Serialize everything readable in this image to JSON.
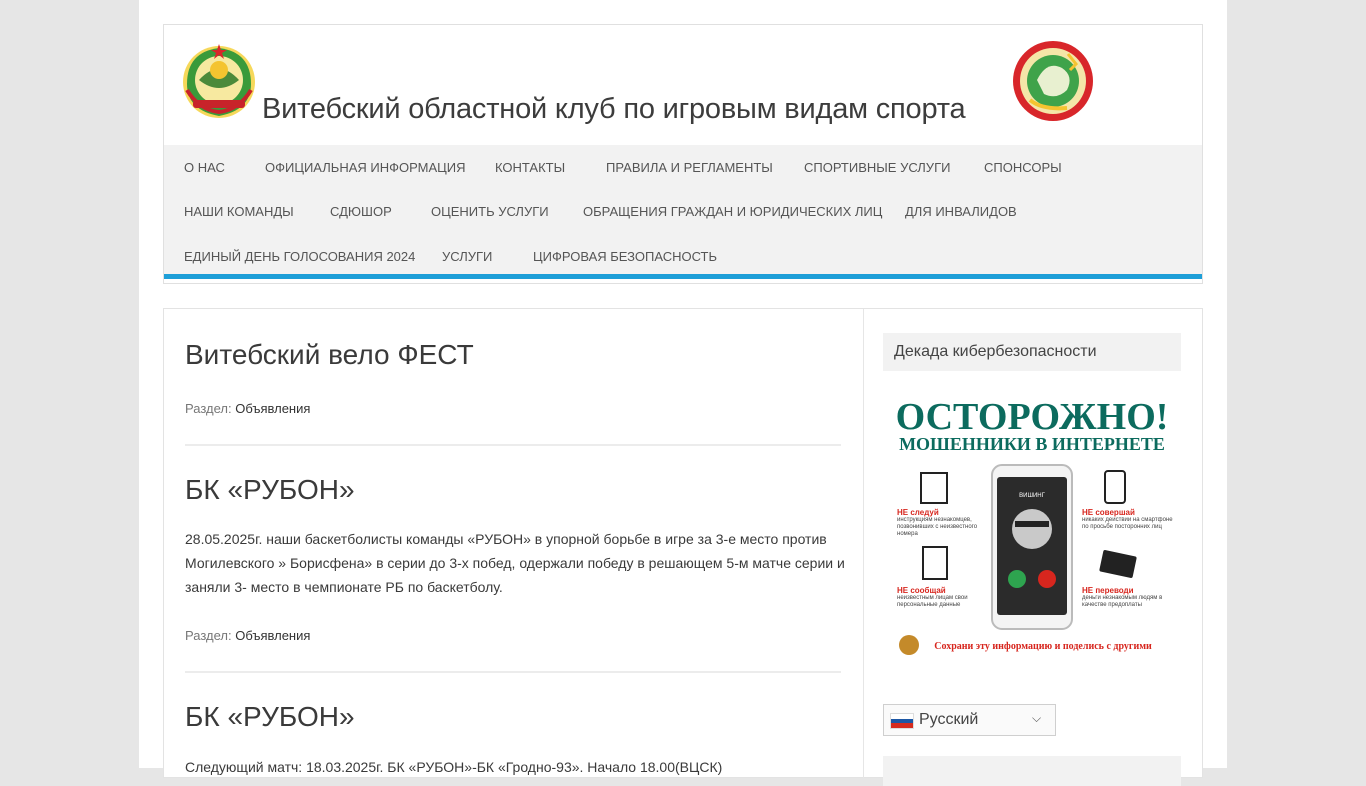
{
  "site": {
    "title": "Витебский областной клуб по игровым видам спорта"
  },
  "nav": {
    "items": [
      "О НАС",
      "ОФИЦИАЛЬНАЯ ИНФОРМАЦИЯ",
      "КОНТАКТЫ",
      "ПРАВИЛА И РЕГЛАМЕНТЫ",
      "СПОРТИВНЫЕ УСЛУГИ",
      "СПОНСОРЫ",
      "НАШИ КОМАНДЫ",
      "СДЮШОР",
      "ОЦЕНИТЬ УСЛУГИ",
      "ОБРАЩЕНИЯ ГРАЖДАН И ЮРИДИЧЕСКИХ ЛИЦ",
      "ДЛЯ ИНВАЛИДОВ",
      "ЕДИНЫЙ ДЕНЬ ГОЛОСОВАНИЯ 2024",
      "УСЛУГИ",
      "ЦИФРОВАЯ БЕЗОПАСНОСТЬ"
    ]
  },
  "posts": [
    {
      "title": "Витебский вело ФЕСТ",
      "text": "",
      "meta_label": "Раздел:",
      "category": "Объявления"
    },
    {
      "title": "БК «РУБОН»",
      "text": "28.05.2025г. наши баскетболисты команды «РУБОН» в упорной борьбе в игре за 3-е место против Могилевского » Борисфена» в серии до 3-х побед, одержали победу в решающем 5-м матче серии и заняли 3- место в чемпионате РБ по баскетболу.",
      "meta_label": "Раздел:",
      "category": "Объявления"
    },
    {
      "title": "БК «РУБОН»",
      "text": "Следующий матч: 18.03.2025г. БК «РУБОН»-БК «Гродно-93». Начало 18.00(ВЦСК)",
      "meta_label": "",
      "category": ""
    }
  ],
  "sidebar": {
    "widget_title": "Декада кибербезопасности",
    "banner": {
      "headline_1": "ОСТОРОЖНО!",
      "headline_2": "МОШЕННИКИ В ИНТЕРНЕТЕ",
      "phone_label": "ВИШИНГ",
      "tip1_red": "НЕ следуй",
      "tip1_text": "инструкциям незнакомцев, позвонивших с неизвестного номера",
      "tip2_red": "НЕ совершай",
      "tip2_text": "никаких действий на смартфоне по просьбе посторонних лиц",
      "tip3_red": "НЕ сообщай",
      "tip3_text": "неизвестным лицам свои персональные данные",
      "tip4_red": "НЕ переводи",
      "tip4_text": "деньги незнакомым людям в качестве предоплаты",
      "footer": "Сохрани эту информацию и поделись с другими",
      "green": "#0c6b5e",
      "red": "#d7261e"
    },
    "language": {
      "selected": "Русский"
    }
  },
  "colors": {
    "accent": "#1e9fd8",
    "nav_bg": "#f2f2f2"
  }
}
